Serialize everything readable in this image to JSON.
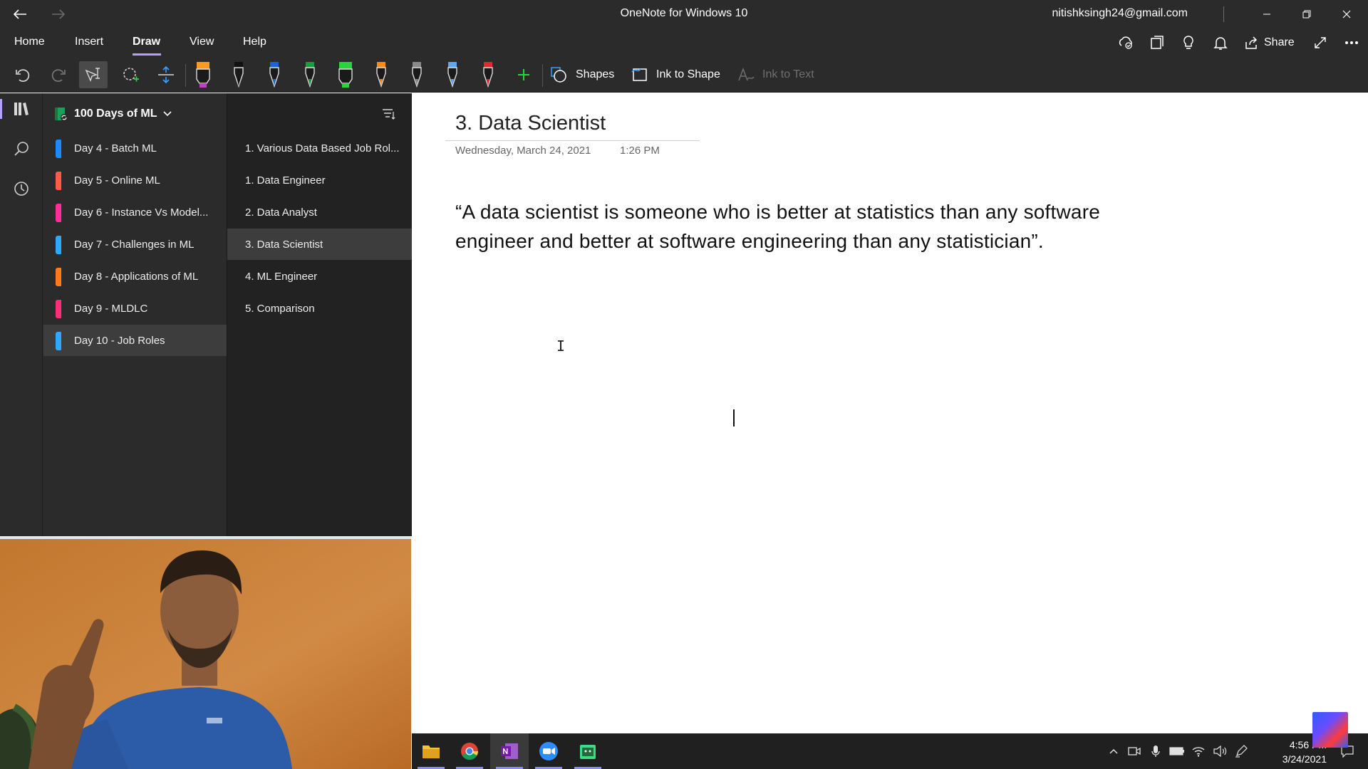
{
  "titlebar": {
    "app_title": "OneNote for Windows 10",
    "account": "nitishksingh24@gmail.com",
    "back_icon": "arrow-left-icon",
    "forward_icon": "arrow-right-icon",
    "window_controls": [
      "minimize-icon",
      "restore-icon",
      "close-icon"
    ]
  },
  "menubar": {
    "tabs": [
      "Home",
      "Insert",
      "Draw",
      "View",
      "Help"
    ],
    "active_tab": "Draw",
    "share_label": "Share",
    "right_icons": [
      "sync-icon",
      "notebook-icon",
      "lightbulb-icon",
      "bell-icon",
      "share-icon",
      "expand-icon",
      "more-icon"
    ]
  },
  "ribbon": {
    "tools": [
      "undo-icon",
      "redo-icon",
      "lasso-select-icon",
      "add-space-icon",
      "vertical-space-icon"
    ],
    "pens": [
      {
        "kind": "highlighter",
        "color": "#ff9a1f",
        "accent": "#c040c0"
      },
      {
        "kind": "pen",
        "color": "#111111"
      },
      {
        "kind": "pen",
        "color": "#1e63d6"
      },
      {
        "kind": "pen",
        "color": "#1a9c3a"
      },
      {
        "kind": "highlighter",
        "color": "#27d63a"
      },
      {
        "kind": "pen",
        "color": "#ff8a1a"
      },
      {
        "kind": "pen",
        "color": "#8a8a8a"
      },
      {
        "kind": "pen",
        "color": "#5aaaf0"
      },
      {
        "kind": "pen",
        "color": "#e8242c"
      }
    ],
    "add_pen_icon": "plus-icon",
    "shapes_label": "Shapes",
    "ink_to_shape_label": "Ink to Shape",
    "ink_to_text_label": "Ink to Text"
  },
  "rail": [
    "notebooks-icon",
    "search-icon",
    "recent-icon"
  ],
  "notebook": {
    "name": "100 Days of ML",
    "icon": "notebook-icon",
    "sections": [
      {
        "label": "Day 4 - Batch ML",
        "color": "#1e88ff"
      },
      {
        "label": "Day 5 - Online ML",
        "color": "#ff5a4a"
      },
      {
        "label": "Day 6 - Instance Vs Model...",
        "color": "#ff2d9a"
      },
      {
        "label": "Day 7 - Challenges in ML",
        "color": "#2ca8ff"
      },
      {
        "label": "Day 8 - Applications of ML",
        "color": "#ff7a1a"
      },
      {
        "label": "Day 9 - MLDLC",
        "color": "#ff2d7a"
      },
      {
        "label": "Day 10 - Job Roles",
        "color": "#2ca8ff"
      }
    ],
    "selected_section": "Day 10 - Job Roles"
  },
  "pages": {
    "items": [
      "1. Various Data Based Job Rol...",
      "1. Data Engineer",
      "2. Data Analyst",
      "3. Data Scientist",
      "4. ML Engineer",
      "5. Comparison"
    ],
    "selected_page": "3. Data Scientist",
    "sort_icon": "sort-icon"
  },
  "page": {
    "title": "3. Data Scientist",
    "date": "Wednesday, March 24, 2021",
    "time": "1:26 PM",
    "body": "“A data scientist is someone who is better at statistics than any software engineer and better at software engineering than any statistician”."
  },
  "taskbar": {
    "apps": [
      "file-explorer-icon",
      "chrome-icon",
      "onenote-icon",
      "zoom-icon",
      "android-studio-icon"
    ],
    "active_app": "onenote-icon",
    "tray": [
      "chevron-up-icon",
      "meet-now-icon",
      "microphone-icon",
      "battery-icon",
      "wifi-icon",
      "volume-icon",
      "pen-icon"
    ],
    "time": "4:56 PM",
    "date": "3/24/2021",
    "notification_icon": "notification-icon"
  }
}
